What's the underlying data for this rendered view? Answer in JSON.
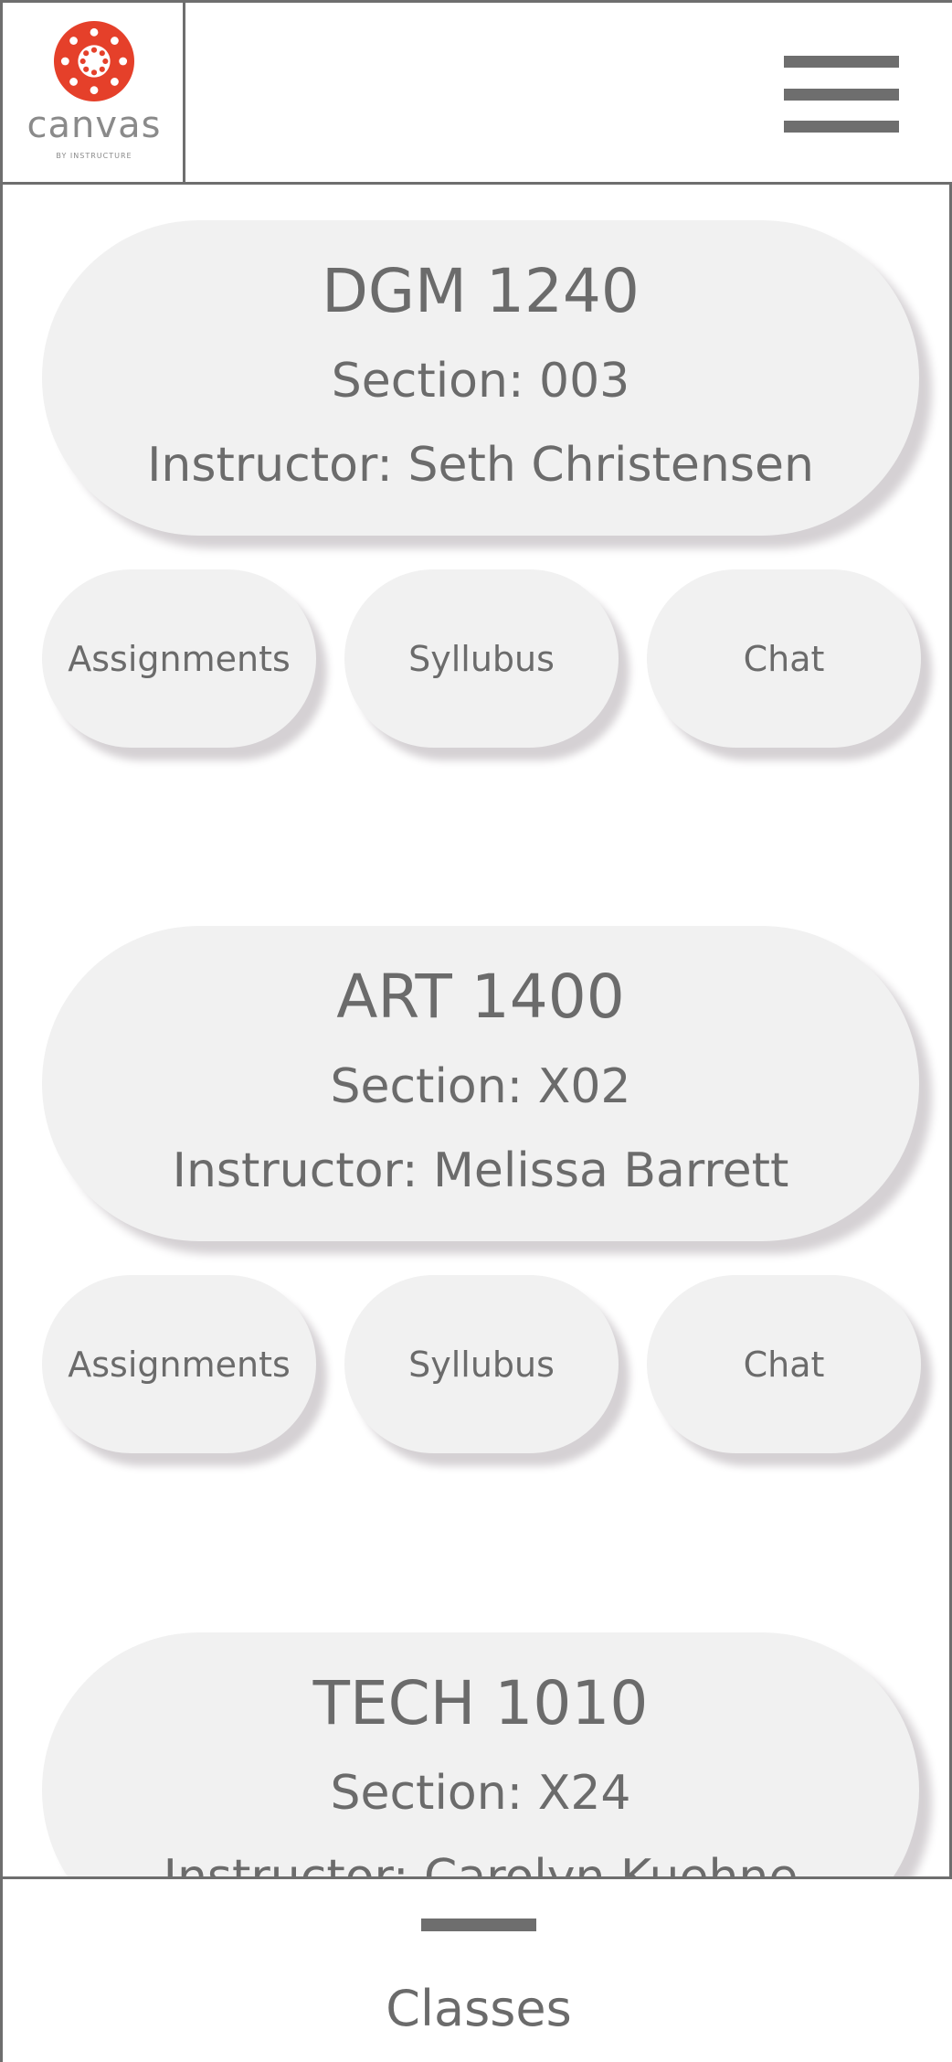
{
  "brand": {
    "wordmark": "canvas",
    "tagline": "BY INSTRUCTURE",
    "accent_color": "#e5402a"
  },
  "header": {
    "menu_icon": "hamburger-menu-icon"
  },
  "courses": [
    {
      "title": "DGM 1240",
      "section": "Section: 003",
      "instructor": "Instructor: Seth Christensen",
      "actions": [
        "Assignments",
        "Syllubus",
        "Chat"
      ]
    },
    {
      "title": "ART 1400",
      "section": "Section: X02",
      "instructor": "Instructor: Melissa Barrett",
      "actions": [
        "Assignments",
        "Syllubus",
        "Chat"
      ]
    },
    {
      "title": "TECH 1010",
      "section": "Section: X24",
      "instructor": "Instructor: Carolyn Kuehne"
    }
  ],
  "bottom_nav": {
    "label": "Classes"
  }
}
